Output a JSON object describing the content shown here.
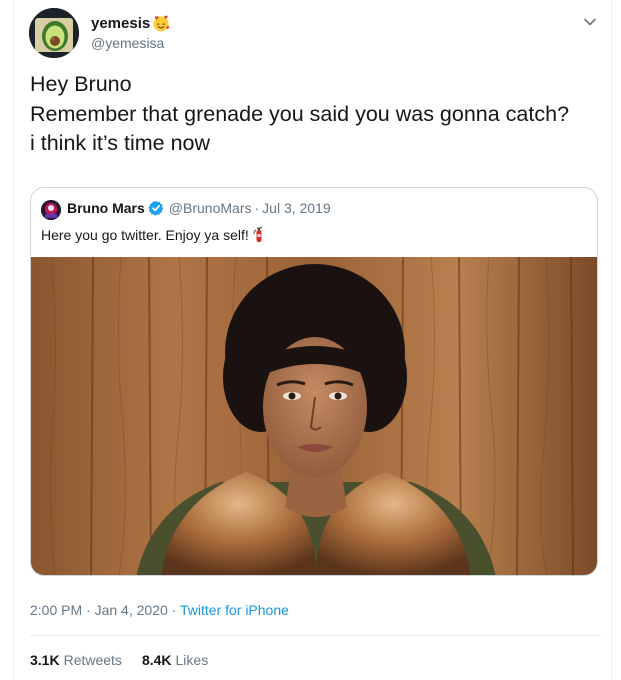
{
  "author": {
    "display_name": "yemesis",
    "name_emoji": "smiling-face-with-hearts",
    "handle": "@yemesisa",
    "avatar": "avocado-art"
  },
  "tweet": {
    "lines": [
      "Hey Bruno",
      "Remember that grenade you said you was gonna catch?",
      "i think it’s time now"
    ]
  },
  "quoted": {
    "name": "Bruno Mars",
    "verified": true,
    "handle": "@BrunoMars",
    "separator": "·",
    "date": "Jul 3, 2019",
    "text": "Here you go twitter. Enjoy ya self!",
    "text_emoji": "fire-extinguisher",
    "image": "portrait-wood-background"
  },
  "meta": {
    "time": "2:00 PM",
    "sep1": "·",
    "date": "Jan 4, 2020",
    "sep2": "·",
    "source": "Twitter for iPhone"
  },
  "stats": {
    "retweets_count": "3.1K",
    "retweets_label": "Retweets",
    "likes_count": "8.4K",
    "likes_label": "Likes"
  },
  "colors": {
    "link": "#1b95e0",
    "muted": "#657786",
    "text": "#14171a",
    "border": "#ccd6dd",
    "verified": "#1da1f2"
  }
}
